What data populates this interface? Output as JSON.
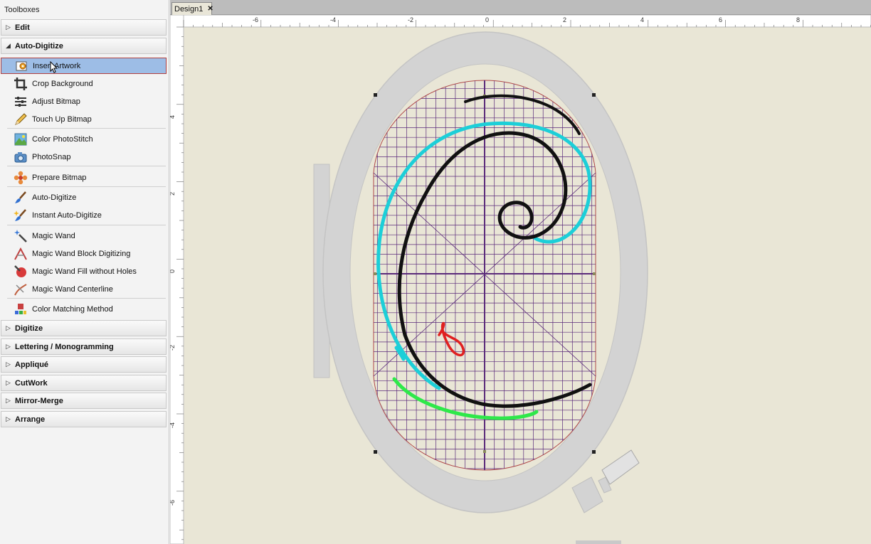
{
  "toolbox": {
    "title": "Toolboxes",
    "categories": {
      "edit": "Edit",
      "auto_digitize": "Auto-Digitize",
      "digitize": "Digitize",
      "lettering": "Lettering / Monogramming",
      "applique": "Appliqué",
      "cutwork": "CutWork",
      "mirror_merge": "Mirror-Merge",
      "arrange": "Arrange"
    },
    "auto_digitize_items": [
      {
        "label": "Insert Artwork",
        "icon": "insert-artwork-icon",
        "selected": true
      },
      {
        "label": "Crop Background",
        "icon": "crop-icon"
      },
      {
        "label": "Adjust Bitmap",
        "icon": "sliders-icon"
      },
      {
        "label": "Touch Up Bitmap",
        "icon": "pencil-icon"
      },
      {
        "label": "Color PhotoStitch",
        "icon": "photo-icon"
      },
      {
        "label": "PhotoSnap",
        "icon": "camera-icon"
      },
      {
        "label": "Prepare Bitmap",
        "icon": "flower-icon"
      },
      {
        "label": "Auto-Digitize",
        "icon": "brush-icon"
      },
      {
        "label": "Instant Auto-Digitize",
        "icon": "brush-spark-icon"
      },
      {
        "label": "Magic Wand",
        "icon": "magic-wand-icon"
      },
      {
        "label": "Magic Wand Block Digitizing",
        "icon": "wand-block-icon"
      },
      {
        "label": "Magic Wand Fill without Holes",
        "icon": "wand-fill-icon"
      },
      {
        "label": "Magic Wand Centerline",
        "icon": "wand-line-icon"
      },
      {
        "label": "Color Matching Method",
        "icon": "color-match-icon"
      }
    ]
  },
  "document": {
    "tab_label": "Design1",
    "close_glyph": "✕"
  },
  "rulers": {
    "horizontal_labels": [
      "-6",
      "-4",
      "-2",
      "0",
      "2",
      "4",
      "6",
      "8"
    ],
    "vertical_labels": [
      "4",
      "2",
      "0",
      "-2",
      "-4",
      "-6"
    ]
  },
  "colors": {
    "canvas_background": "#e9e6d6",
    "hoop": "#d3d3d3",
    "grid": "#5a2a7a",
    "hoop_outline": "#b04848",
    "stroke_black": "#111111",
    "stroke_cyan": "#1ccfd8",
    "stroke_green": "#2ee84a",
    "stroke_red": "#e02020",
    "selection_highlight": "#9dbde6"
  }
}
